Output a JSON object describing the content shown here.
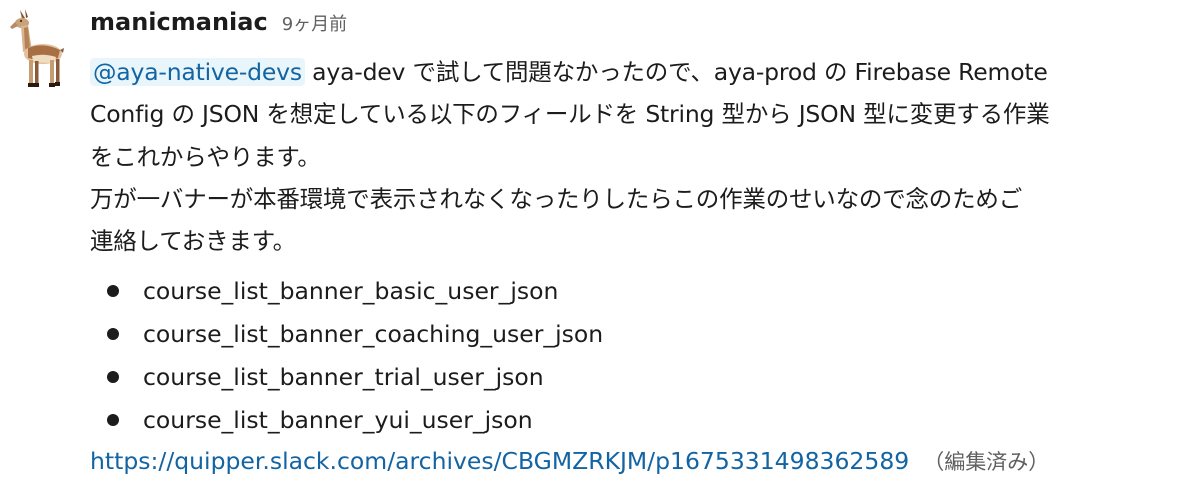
{
  "avatar": {
    "icon": "llama-icon"
  },
  "message": {
    "username": "manicmaniac",
    "timestamp": "9ヶ月前",
    "mention": "@aya-native-devs",
    "line1_after_mention": " aya-dev で試して問題なかったので、aya-prod の Firebase Remote",
    "line2": "Config の JSON を想定している以下のフィールドを String 型から JSON 型に変更する作業",
    "line3": "をこれからやります。",
    "line4": "万が一バナーが本番環境で表示されなくなったりしたらこの作業のせいなので念のためご",
    "line5": "連絡しておきます。",
    "fields": [
      "course_list_banner_basic_user_json",
      "course_list_banner_coaching_user_json",
      "course_list_banner_trial_user_json",
      "course_list_banner_yui_user_json"
    ],
    "link": "https://quipper.slack.com/archives/CBGMZRKJM/p1675331498362589",
    "edited": "（編集済み）"
  },
  "colors": {
    "text": "#1d1c1d",
    "muted": "#616061",
    "link": "#1264a3",
    "mention_bg": "#e8f5fa"
  }
}
